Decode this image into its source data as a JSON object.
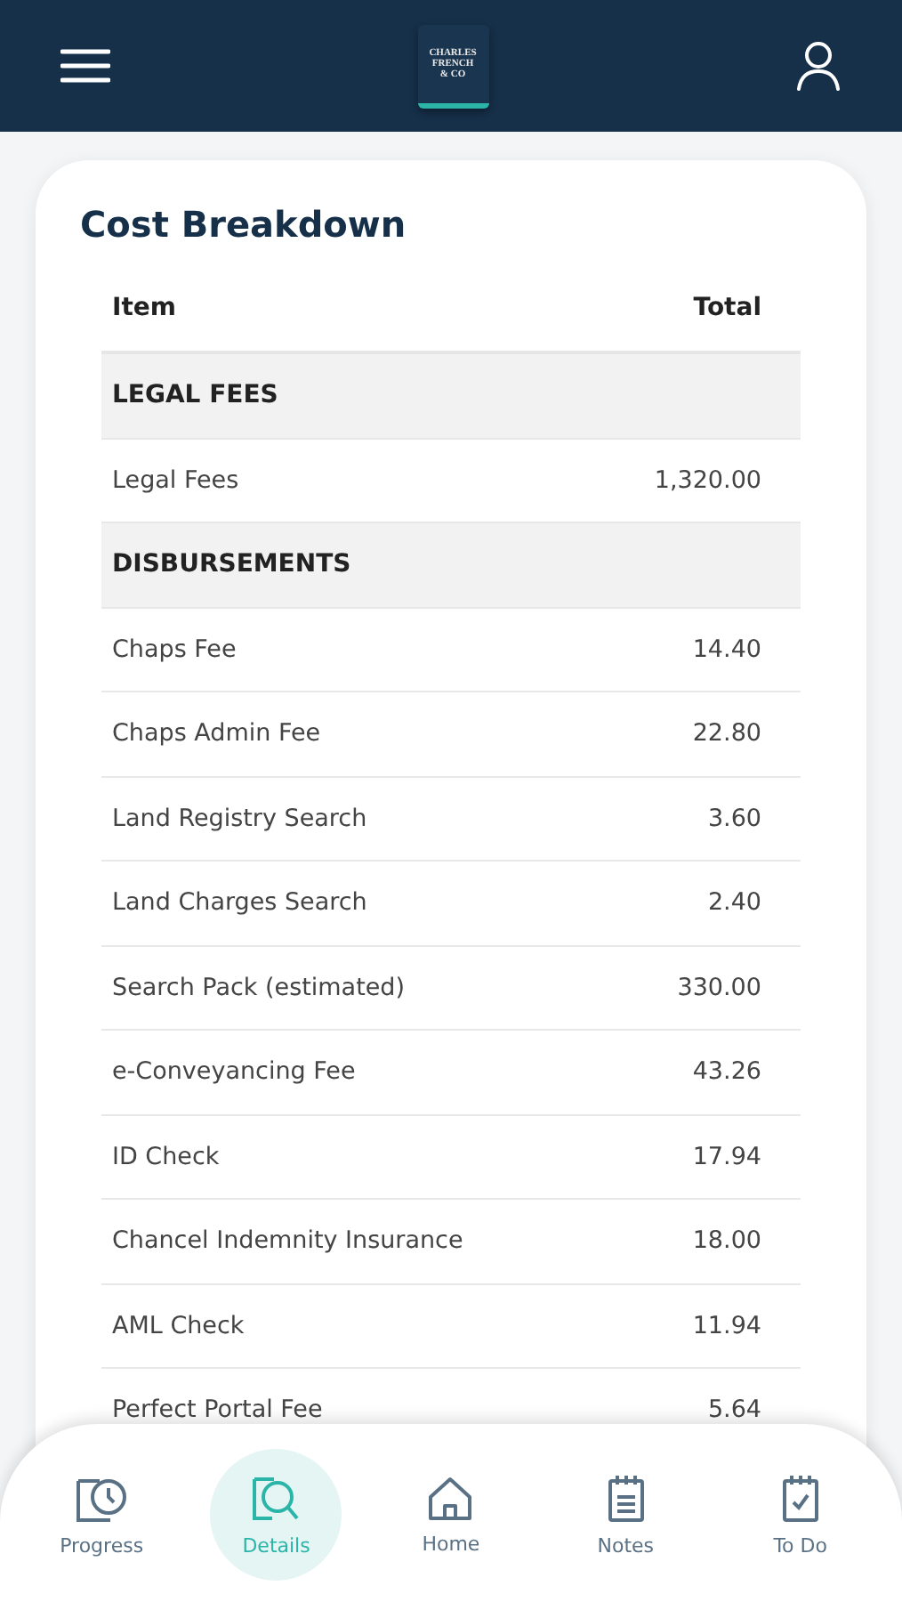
{
  "header": {
    "logo_lines": [
      "CHARLES",
      "FRENCH",
      "& CO"
    ]
  },
  "card": {
    "title": "Cost Breakdown",
    "columns": [
      "Item",
      "Total"
    ],
    "rows": [
      {
        "kind": "section",
        "label": "LEGAL FEES"
      },
      {
        "kind": "item",
        "label": "Legal Fees",
        "total": "1,320.00"
      },
      {
        "kind": "section",
        "label": "DISBURSEMENTS"
      },
      {
        "kind": "item",
        "label": "Chaps Fee",
        "total": "14.40"
      },
      {
        "kind": "item",
        "label": "Chaps Admin Fee",
        "total": "22.80"
      },
      {
        "kind": "item",
        "label": "Land Registry Search",
        "total": "3.60"
      },
      {
        "kind": "item",
        "label": "Land Charges Search",
        "total": "2.40"
      },
      {
        "kind": "item",
        "label": "Search Pack (estimated)",
        "total": "330.00"
      },
      {
        "kind": "item",
        "label": "e-Conveyancing Fee",
        "total": "43.26"
      },
      {
        "kind": "item",
        "label": "ID Check",
        "total": "17.94"
      },
      {
        "kind": "item",
        "label": "Chancel Indemnity Insurance",
        "total": "18.00"
      },
      {
        "kind": "item",
        "label": "AML Check",
        "total": "11.94"
      },
      {
        "kind": "item",
        "label": "Perfect Portal Fee",
        "total": "5.64"
      }
    ]
  },
  "nav": [
    {
      "kind": "progress",
      "label": "Progress",
      "selected": false
    },
    {
      "kind": "details",
      "label": "Details",
      "selected": true
    },
    {
      "kind": "home",
      "label": "Home",
      "selected": false
    },
    {
      "kind": "notes",
      "label": "Notes",
      "selected": false
    },
    {
      "kind": "todo",
      "label": "To Do",
      "selected": false
    }
  ]
}
